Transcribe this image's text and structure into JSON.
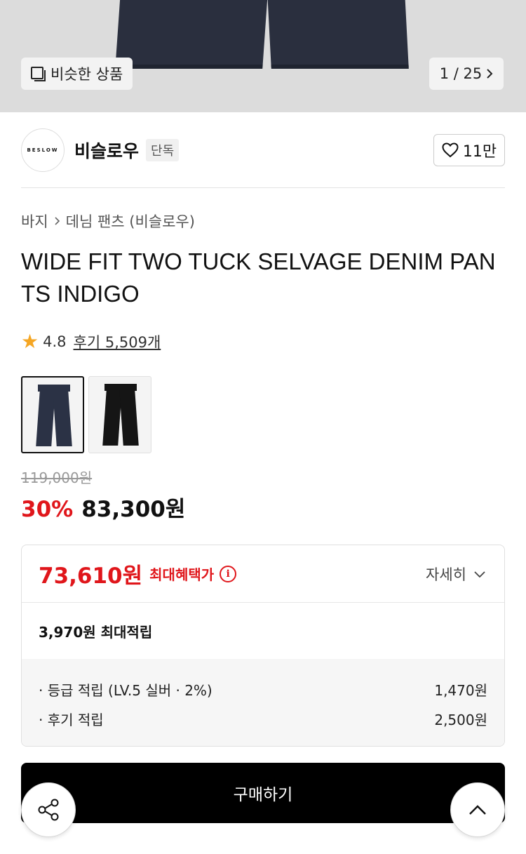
{
  "hero": {
    "similar_label": "비슷한 상품",
    "counter": "1 / 25"
  },
  "brand": {
    "logo_text": "BESLOW",
    "name": "비슬로우",
    "badge": "단독",
    "like_count": "11만"
  },
  "breadcrumb": {
    "category": "바지",
    "subcategory": "데님 팬츠 (비슬로우)"
  },
  "product": {
    "title": "WIDE FIT TWO TUCK SELVAGE DENIM PANTS INDIGO",
    "rating": "4.8",
    "reviews": "후기 5,509개",
    "original_price": "119,000원",
    "discount": "30%",
    "sale_price": "83,300원",
    "color_options": [
      {
        "name": "indigo",
        "color": "#2b3245",
        "selected": true
      },
      {
        "name": "black",
        "color": "#151515",
        "selected": false
      }
    ]
  },
  "benefit": {
    "max_price": "73,610원",
    "max_label": "최대혜택가",
    "detail_label": "자세히",
    "points_total": "3,970원 최대적립",
    "rows": [
      {
        "label": "· 등급 적립 (LV.5 실버 · 2%)",
        "value": "1,470원"
      },
      {
        "label": "· 후기 적립",
        "value": "2,500원"
      }
    ]
  },
  "actions": {
    "buy_label": "구매하기"
  },
  "colors": {
    "accent_red": "#e0161b",
    "button_black": "#000000"
  }
}
